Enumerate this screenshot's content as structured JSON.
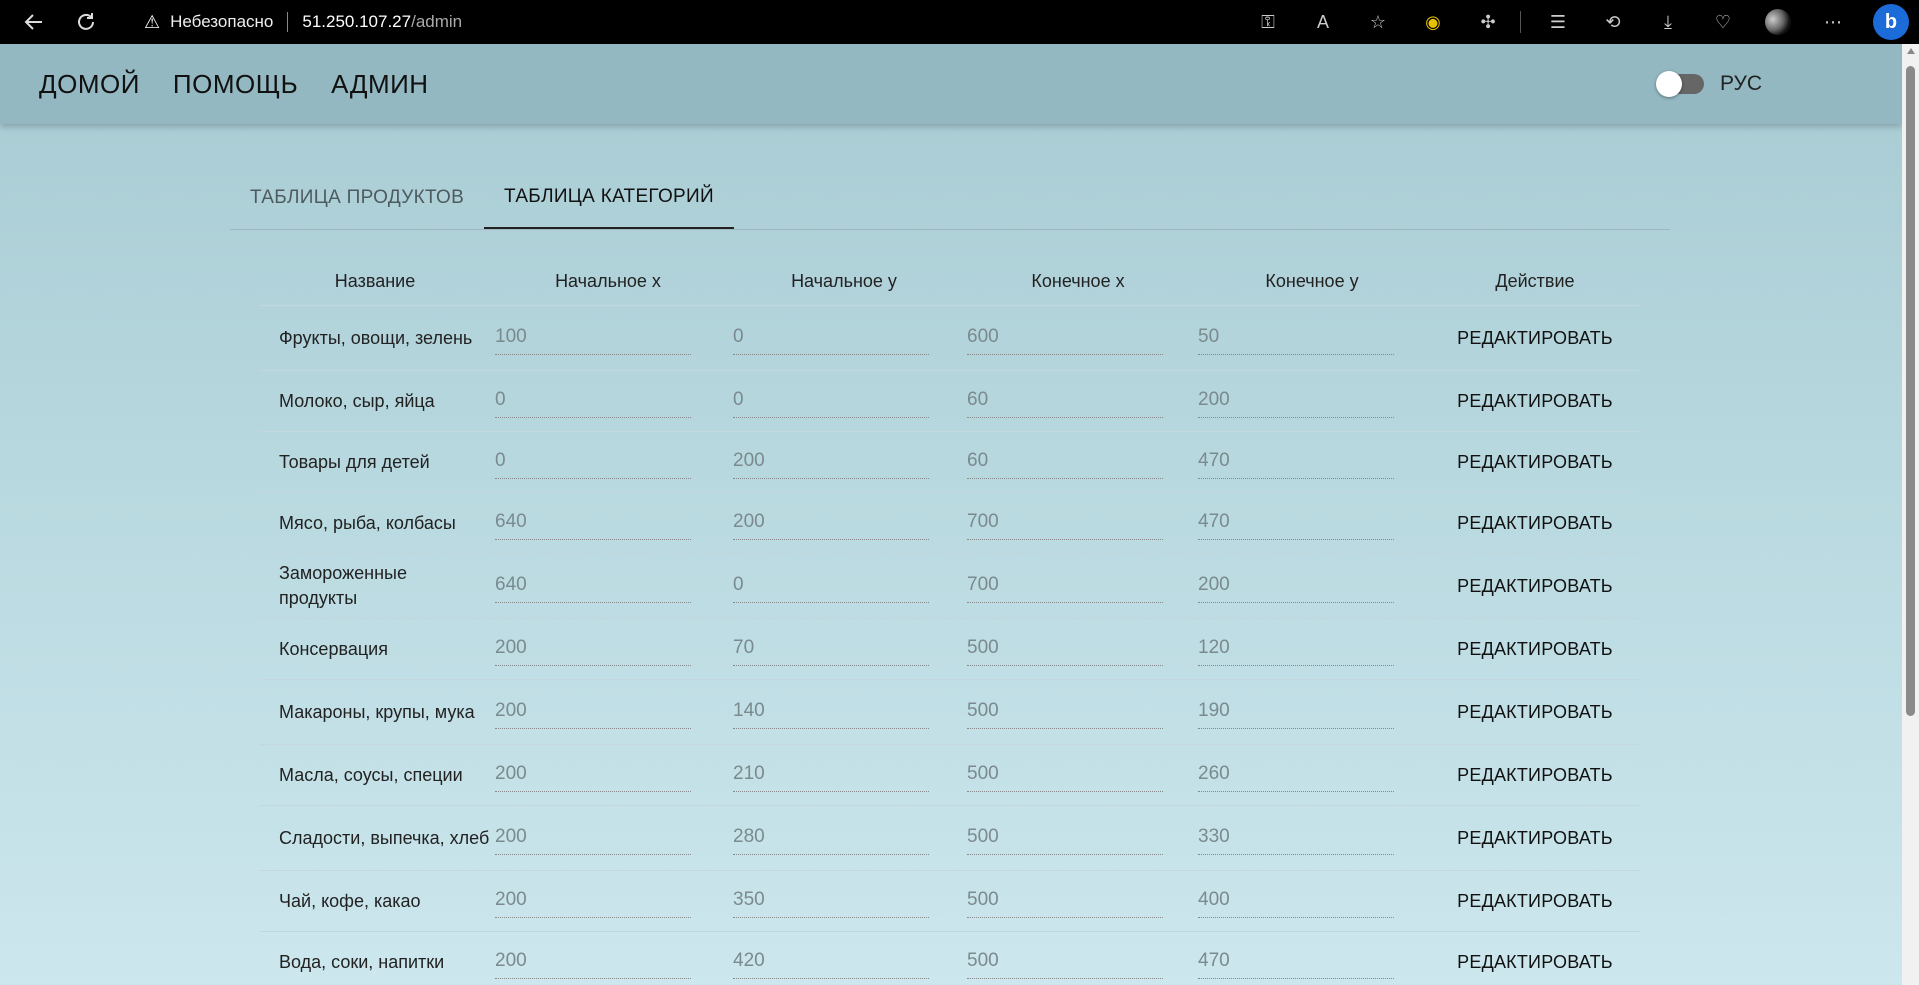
{
  "browser": {
    "security_label": "Небезопасно",
    "url_host": "51.250.107.27",
    "url_path": "/admin"
  },
  "nav": {
    "home": "ДОМОЙ",
    "help": "ПОМОЩЬ",
    "admin": "АДМИН",
    "language": "РУС"
  },
  "tabs": {
    "products": "ТАБЛИЦА ПРОДУКТОВ",
    "categories": "ТАБЛИЦА КАТЕГОРИЙ"
  },
  "table": {
    "headers": [
      "Название",
      "Начальное x",
      "Начальное y",
      "Конечное x",
      "Конечное y",
      "Действие"
    ],
    "action_label": "РЕДАКТИРОВАТЬ",
    "rows": [
      {
        "name": "Фрукты, овощи, зелень",
        "x1": "100",
        "y1": "0",
        "x2": "600",
        "y2": "50"
      },
      {
        "name": "Молоко, сыр, яйца",
        "x1": "0",
        "y1": "0",
        "x2": "60",
        "y2": "200"
      },
      {
        "name": "Товары для детей",
        "x1": "0",
        "y1": "200",
        "x2": "60",
        "y2": "470"
      },
      {
        "name": "Мясо, рыба, колбасы",
        "x1": "640",
        "y1": "200",
        "x2": "700",
        "y2": "470"
      },
      {
        "name": "Замороженные продукты",
        "x1": "640",
        "y1": "0",
        "x2": "700",
        "y2": "200"
      },
      {
        "name": "Консервация",
        "x1": "200",
        "y1": "70",
        "x2": "500",
        "y2": "120"
      },
      {
        "name": "Макароны, крупы, мука",
        "x1": "200",
        "y1": "140",
        "x2": "500",
        "y2": "190"
      },
      {
        "name": "Масла, соусы, специи",
        "x1": "200",
        "y1": "210",
        "x2": "500",
        "y2": "260"
      },
      {
        "name": "Сладости, выпечка, хлеб",
        "x1": "200",
        "y1": "280",
        "x2": "500",
        "y2": "330"
      },
      {
        "name": "Чай, кофе, какао",
        "x1": "200",
        "y1": "350",
        "x2": "500",
        "y2": "400"
      },
      {
        "name": "Вода, соки, напитки",
        "x1": "200",
        "y1": "420",
        "x2": "500",
        "y2": "470"
      }
    ]
  }
}
